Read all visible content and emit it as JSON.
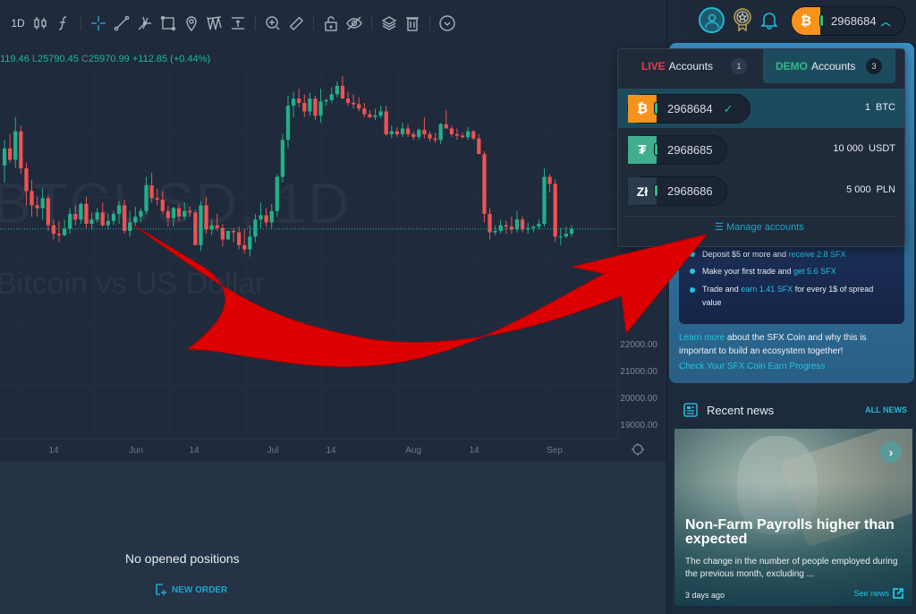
{
  "toolbar": {
    "interval": "1D",
    "tools": [
      "candles-icon",
      "indicators-icon",
      "crosshair-icon",
      "trendline-icon",
      "pitchfork-icon",
      "rectangle-icon",
      "pin-icon",
      "pattern-icon",
      "measure-text-icon",
      "zoom-in-icon",
      "ruler-icon",
      "lock-icon",
      "hide-icon",
      "layers-icon",
      "trash-icon",
      "download-icon"
    ]
  },
  "ohlc": {
    "high_partial": "119.46",
    "low_label": "L",
    "low": "25790.45",
    "close_label": "C",
    "close": "25970.99",
    "change": "+112.85 (+0.44%)"
  },
  "chart": {
    "symbol_watermark": "BTCUSD, 1D",
    "description_watermark": "Bitcoin vs US Dollar",
    "price_labels": [
      "22000.00",
      "21000.00",
      "20000.00",
      "19000.00"
    ],
    "time_labels": [
      "14",
      "Jun",
      "14",
      "Jul",
      "14",
      "Aug",
      "14",
      "Sep"
    ],
    "colors": {
      "up": "#22b089",
      "down": "#ef5350",
      "background": "#1f2a3c"
    }
  },
  "chart_data": {
    "type": "candlestick",
    "title": "BTCUSD, 1D",
    "subtitle": "Bitcoin vs US Dollar",
    "xlabel": "",
    "ylabel": "",
    "x_ticks": [
      "14",
      "Jun",
      "14",
      "Jul",
      "14",
      "Aug",
      "14",
      "Sep"
    ],
    "y_ticks": [
      19000,
      20000,
      21000,
      22000
    ],
    "ylim": [
      18600,
      31500
    ],
    "last_close": 25970.99,
    "ohlc_readout": {
      "low": 25790.45,
      "close": 25970.99,
      "change": 112.85,
      "change_pct": 0.44
    },
    "candles": [
      [
        28200,
        29100,
        27600,
        28800
      ],
      [
        28800,
        29300,
        28300,
        28400
      ],
      [
        28400,
        29900,
        28100,
        29400
      ],
      [
        29400,
        29600,
        27900,
        28100
      ],
      [
        28100,
        28300,
        26800,
        27300
      ],
      [
        27300,
        27700,
        26400,
        26800
      ],
      [
        26800,
        27100,
        26400,
        26700
      ],
      [
        26700,
        27400,
        26300,
        27050
      ],
      [
        27050,
        27150,
        25900,
        26100
      ],
      [
        26100,
        26300,
        25600,
        25800
      ],
      [
        25800,
        26250,
        25500,
        25750
      ],
      [
        25750,
        26300,
        25700,
        25980
      ],
      [
        25980,
        26700,
        25800,
        26500
      ],
      [
        26500,
        26800,
        26100,
        26300
      ],
      [
        26300,
        26900,
        26150,
        26850
      ],
      [
        26850,
        27100,
        26000,
        26150
      ],
      [
        26150,
        26550,
        25950,
        26300
      ],
      [
        26300,
        26700,
        26200,
        26550
      ],
      [
        26550,
        26900,
        26050,
        26100
      ],
      [
        26100,
        26500,
        25950,
        26250
      ],
      [
        26250,
        26600,
        26100,
        26500
      ],
      [
        26500,
        26950,
        26150,
        26800
      ],
      [
        26800,
        27000,
        25800,
        25900
      ],
      [
        25900,
        26600,
        25700,
        26200
      ],
      [
        26200,
        26750,
        26050,
        26400
      ],
      [
        26400,
        26700,
        26200,
        26600
      ],
      [
        26600,
        27800,
        26500,
        27500
      ],
      [
        27500,
        27950,
        26900,
        27050
      ],
      [
        27050,
        27400,
        26800,
        27000
      ],
      [
        27000,
        27300,
        26500,
        26600
      ],
      [
        26600,
        26800,
        26050,
        26350
      ],
      [
        26350,
        26750,
        26050,
        26700
      ],
      [
        26700,
        26850,
        26250,
        26400
      ],
      [
        26400,
        26900,
        26300,
        26600
      ],
      [
        26600,
        26750,
        26400,
        26550
      ],
      [
        26550,
        26650,
        25500,
        25400
      ],
      [
        25400,
        26950,
        25200,
        26800
      ],
      [
        26800,
        27100,
        25800,
        25950
      ],
      [
        25950,
        26300,
        25750,
        26100
      ],
      [
        26100,
        26500,
        25900,
        26000
      ],
      [
        26000,
        26150,
        25350,
        25600
      ],
      [
        25600,
        25900,
        25700,
        25900
      ],
      [
        25900,
        26000,
        25500,
        25850
      ],
      [
        25850,
        26050,
        25250,
        25400
      ],
      [
        25400,
        25950,
        25100,
        25250
      ],
      [
        25250,
        26100,
        25000,
        25700
      ],
      [
        25700,
        26500,
        25500,
        26300
      ],
      [
        26300,
        26900,
        26000,
        26450
      ],
      [
        26450,
        26700,
        26050,
        26200
      ],
      [
        26200,
        26850,
        26000,
        26600
      ],
      [
        26600,
        27900,
        26400,
        27800
      ],
      [
        27800,
        29300,
        27600,
        29100
      ],
      [
        29100,
        30650,
        28800,
        30300
      ],
      [
        30300,
        30800,
        29900,
        30550
      ],
      [
        30550,
        30900,
        30250,
        30400
      ],
      [
        30400,
        30700,
        29900,
        30100
      ],
      [
        30100,
        30750,
        29950,
        30550
      ],
      [
        30550,
        30650,
        29800,
        29950
      ],
      [
        29950,
        30900,
        29700,
        30450
      ],
      [
        30450,
        30550,
        30300,
        30500
      ],
      [
        30500,
        30950,
        30400,
        30700
      ],
      [
        30700,
        31150,
        30600,
        31000
      ],
      [
        31000,
        31350,
        30550,
        30550
      ],
      [
        30550,
        30800,
        30300,
        30400
      ],
      [
        30400,
        30700,
        30200,
        30350
      ],
      [
        30350,
        30600,
        30100,
        30200
      ],
      [
        30200,
        30400,
        29900,
        30000
      ],
      [
        30000,
        30150,
        29850,
        29900
      ],
      [
        29900,
        30200,
        29800,
        29950
      ],
      [
        29950,
        30300,
        29850,
        30100
      ],
      [
        30100,
        30300,
        29250,
        29300
      ],
      [
        29300,
        29600,
        29150,
        29400
      ],
      [
        29400,
        29550,
        29200,
        29300
      ],
      [
        29300,
        29700,
        29200,
        29500
      ],
      [
        29500,
        29650,
        29200,
        29300
      ],
      [
        29300,
        29400,
        29100,
        29200
      ],
      [
        29200,
        29500,
        29100,
        29450
      ],
      [
        29450,
        29900,
        29150,
        29300
      ],
      [
        29300,
        29400,
        29050,
        29150
      ],
      [
        29150,
        29350,
        29000,
        29100
      ],
      [
        29100,
        29700,
        28950,
        29650
      ],
      [
        29650,
        30150,
        29500,
        29500
      ],
      [
        29500,
        29600,
        29200,
        29300
      ],
      [
        29300,
        29500,
        29100,
        29250
      ],
      [
        29250,
        29350,
        29150,
        29200
      ],
      [
        29200,
        29550,
        29100,
        29400
      ],
      [
        29400,
        29450,
        29100,
        29150
      ],
      [
        29150,
        29300,
        28800,
        28600
      ],
      [
        28600,
        28700,
        26200,
        26500
      ],
      [
        26500,
        26700,
        25600,
        25850
      ],
      [
        25850,
        26100,
        25750,
        25900
      ],
      [
        25900,
        26300,
        25800,
        26100
      ],
      [
        26100,
        26250,
        25800,
        26050
      ],
      [
        26050,
        26400,
        25800,
        25950
      ],
      [
        25950,
        26600,
        25850,
        26300
      ],
      [
        26300,
        26400,
        25850,
        25950
      ],
      [
        25950,
        26200,
        25800,
        26000
      ],
      [
        26000,
        26100,
        25850,
        26050
      ],
      [
        26050,
        26300,
        25950,
        26150
      ],
      [
        26150,
        28100,
        26050,
        27800
      ],
      [
        27800,
        27900,
        27250,
        27550
      ],
      [
        27550,
        27700,
        25500,
        25700
      ],
      [
        25700,
        26000,
        25400,
        25700
      ],
      [
        25700,
        26050,
        25650,
        25800
      ],
      [
        25800,
        26100,
        25700,
        25970
      ]
    ]
  },
  "topbar": {
    "account_number": "2968684",
    "account_currency_icon": "bitcoin-icon"
  },
  "dropdown": {
    "tabs": [
      {
        "prefix": "LIVE",
        "label": "Accounts",
        "count": "1"
      },
      {
        "prefix": "DEMO",
        "label": "Accounts",
        "count": "3"
      }
    ],
    "accounts": [
      {
        "icon": "₿",
        "icon_name": "bitcoin-icon",
        "icon_color": "#f7931a",
        "number": "2968684",
        "selected": true,
        "amount": "1",
        "currency": "BTC"
      },
      {
        "icon": "₮",
        "icon_name": "tether-icon",
        "icon_color": "#3fae8f",
        "number": "2968685",
        "selected": false,
        "amount": "10 000",
        "currency": "USDT"
      },
      {
        "icon": "Zł",
        "icon_name": "zloty-icon",
        "icon_color": "#2b3a4c",
        "number": "2968686",
        "selected": false,
        "amount": "5 000",
        "currency": "PLN"
      }
    ],
    "check": "✓",
    "manage_label": "Manage accounts"
  },
  "promo": {
    "bullets": [
      {
        "text": "Deposit $5 or more and ",
        "highlight": "receive 2.8 SFX",
        "after": ""
      },
      {
        "text": "Make your first trade and ",
        "highlight": "get 5.6 SFX",
        "after": ""
      },
      {
        "text": "Trade and ",
        "highlight": "earn 1.41 SFX",
        "after": " for every 1$ of spread",
        "line2": "value"
      }
    ],
    "learn_more": "Learn more",
    "learn_text_1": " about the SFX Coin and why this is",
    "learn_text_2": "important to build an ecosystem together!",
    "progress_link": "Check Your SFX Coin Earn Progress"
  },
  "news": {
    "title": "Recent news",
    "all_news": "ALL NEWS",
    "headline": "Non-Farm Payrolls higher than expected",
    "summary": "The change in the number of people employed during the previous month, excluding ...",
    "time": "3 days ago",
    "see_news": "See news"
  },
  "positions": {
    "empty_text": "No opened positions",
    "new_order": "NEW ORDER"
  }
}
